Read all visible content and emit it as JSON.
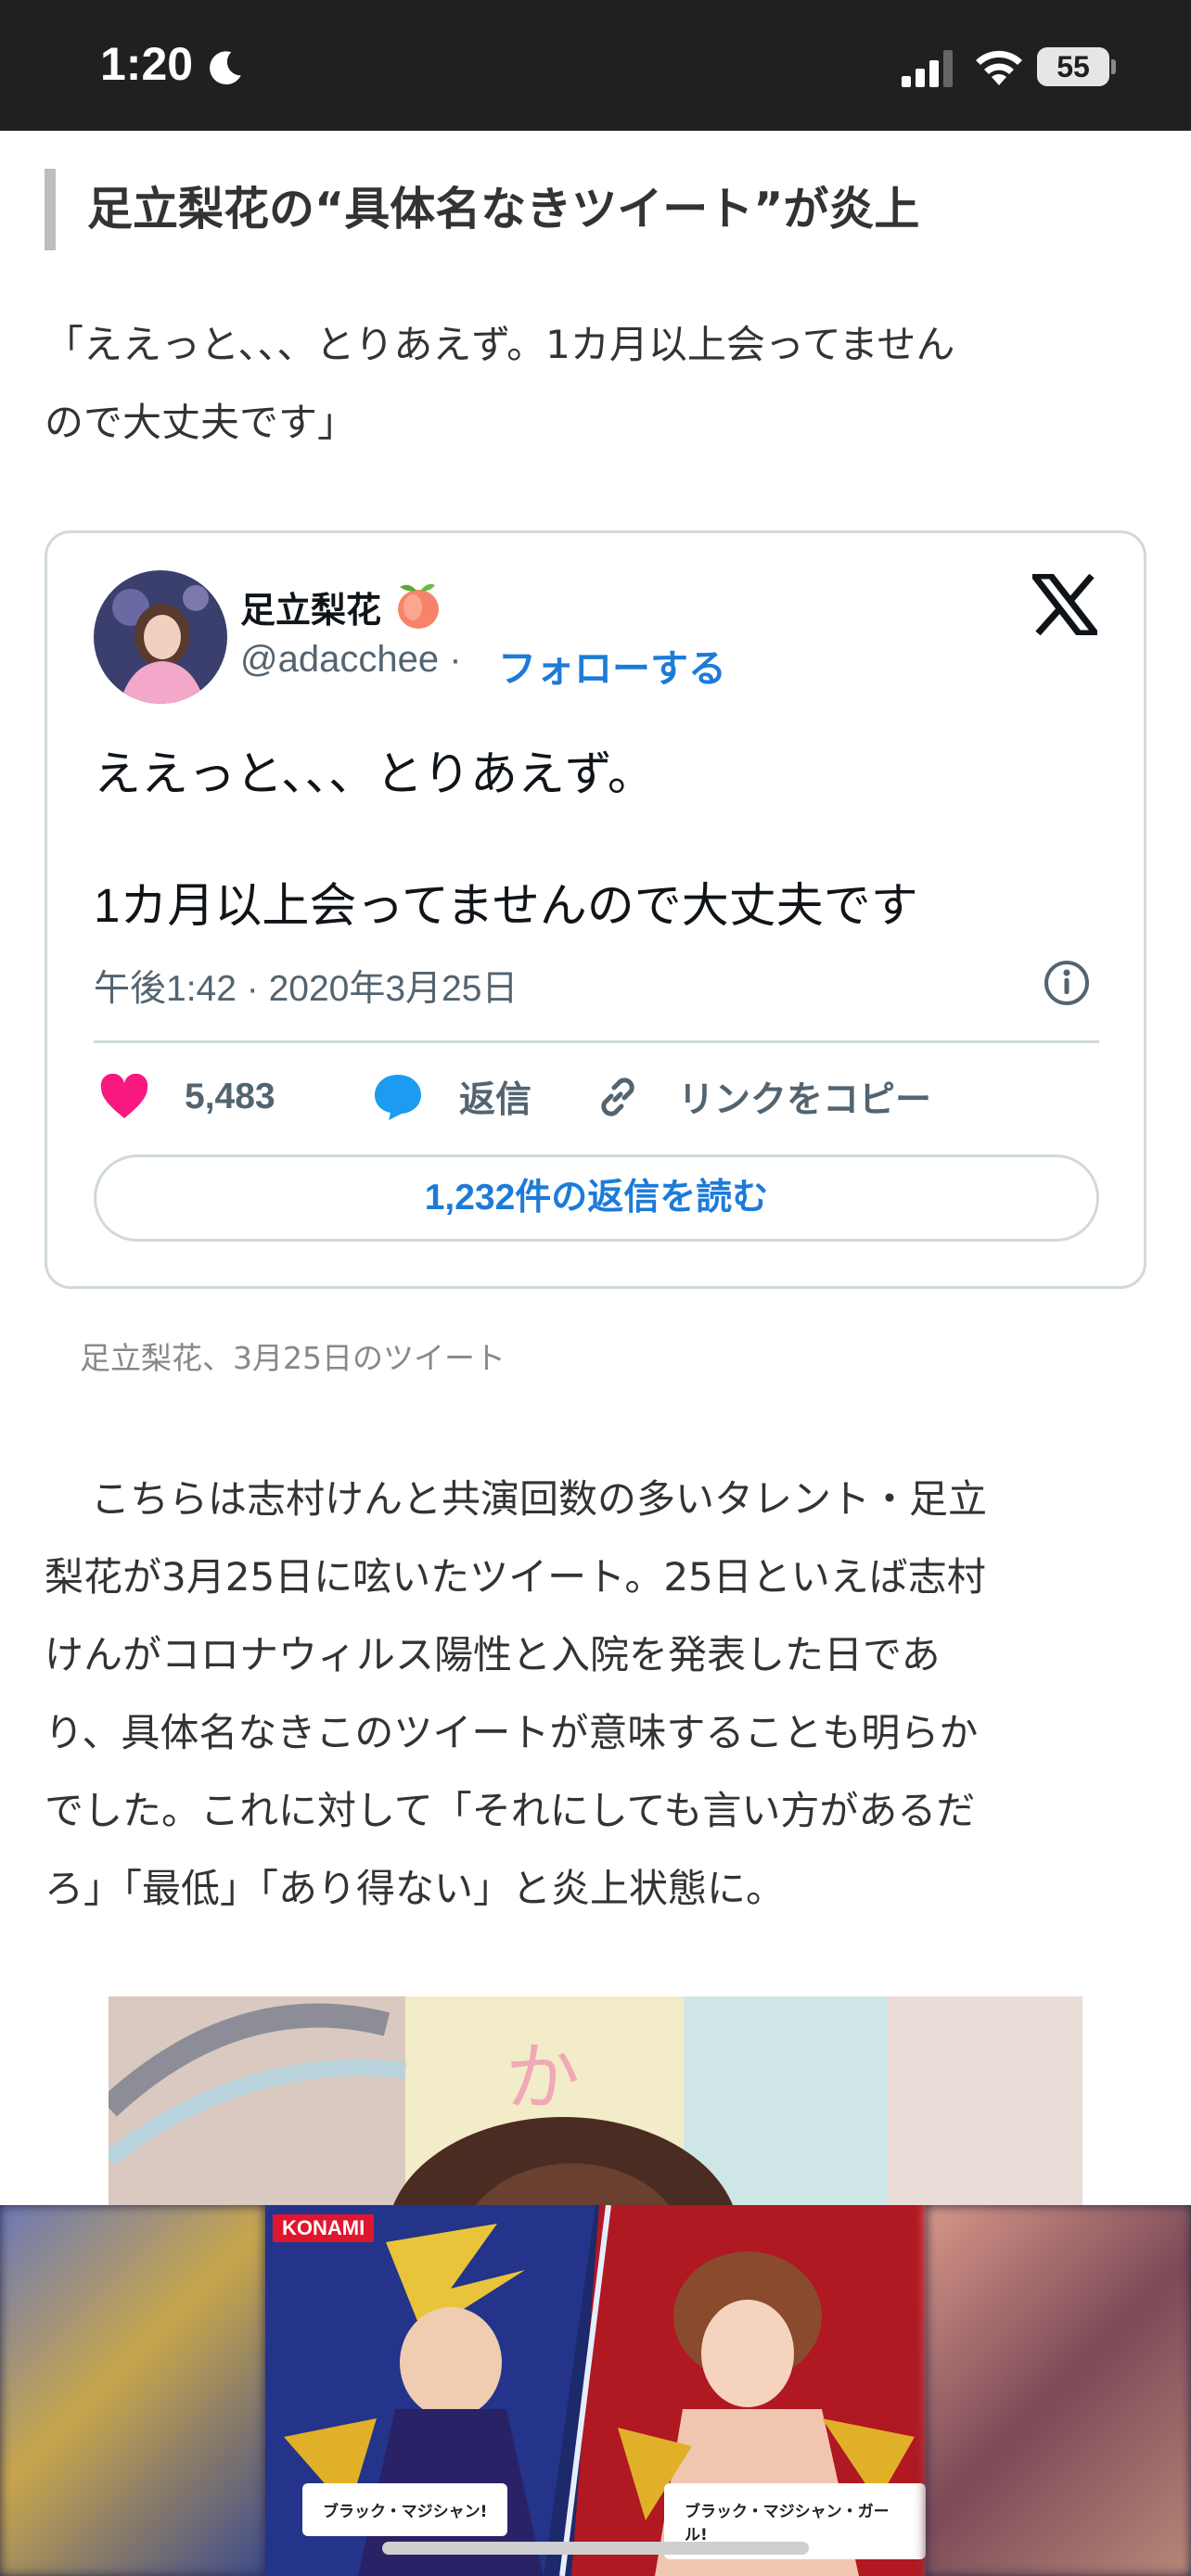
{
  "status_bar": {
    "time": "1:20",
    "battery": "55"
  },
  "article": {
    "heading": "足立梨花の“具体名なきツイート”が炎上",
    "quote_line1": "「ええっと、、、とりあえず。1カ月以上会ってません",
    "quote_line2": "ので大丈夫です」",
    "caption": "足立梨花、3月25日のツイート",
    "body_line1": "こちらは志村けんと共演回数の多いタレント・足立",
    "body_line2": "梨花が3月25日に呟いたツイート。25日といえば志村",
    "body_line3": "けんがコロナウィルス陽性と入院を発表した日であ",
    "body_line4": "り、具体名なきこのツイートが意味することも明らか",
    "body_line5": "でした。これに対して「それにしても言い方があるだ",
    "body_line6": "ろ」「最低」「あり得ない」と炎上状態に。",
    "photo_text": "か"
  },
  "tweet": {
    "author_name": "足立梨花",
    "author_emoji": "🍑",
    "handle": "@adacchee ·",
    "follow": "フォローする",
    "text_line1": "ええっと、、、とりあえず。",
    "text_line2": "1カ月以上会ってませんので大丈夫です",
    "timestamp": "午後1:42 · 2020年3月25日",
    "likes": "5,483",
    "reply": "返信",
    "copy_link": "リンクをコピー",
    "read_replies": "1,232件の返信を読む"
  },
  "ad": {
    "brand": "KONAMI",
    "label_left": "ブラック・マジシャン!",
    "label_right": "ブラック・マジシャン・ガール!"
  },
  "colors": {
    "status_bar": "#202020",
    "link_blue": "#1d7bd8",
    "like_pink": "#f91880",
    "reply_blue": "#1d9bf0"
  }
}
